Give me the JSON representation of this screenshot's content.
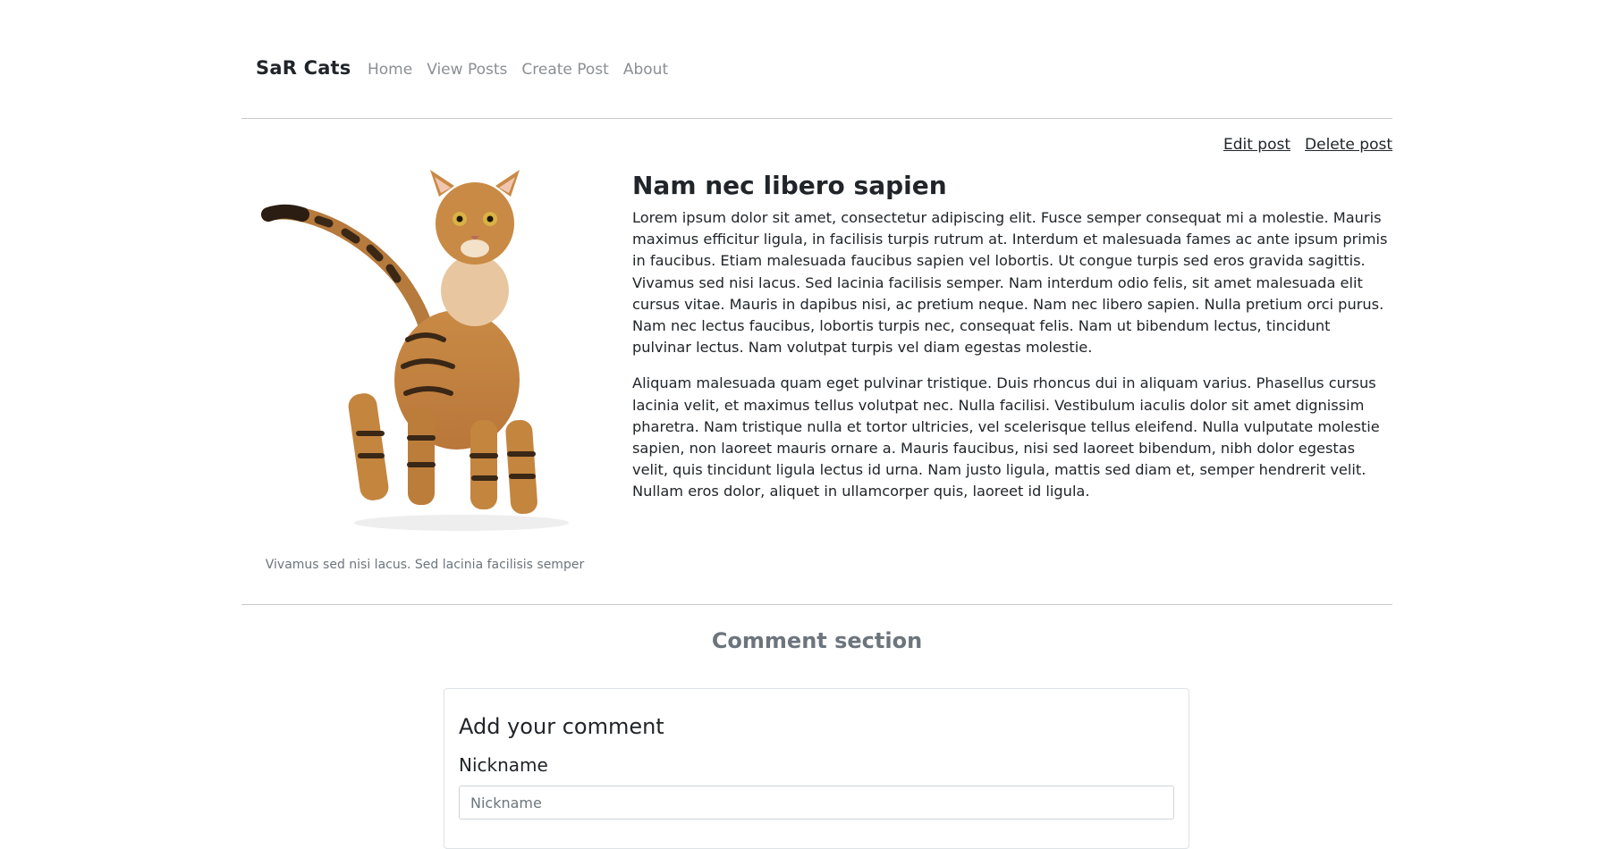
{
  "navbar": {
    "brand": "SaR Cats",
    "links": [
      "Home",
      "View Posts",
      "Create Post",
      "About"
    ]
  },
  "post_actions": {
    "edit_label": "Edit post",
    "delete_label": "Delete post"
  },
  "post": {
    "image_caption": "Vivamus sed nisi lacus. Sed lacinia facilisis semper",
    "title": "Nam nec libero sapien",
    "paragraphs": [
      "Lorem ipsum dolor sit amet, consectetur adipiscing elit. Fusce semper consequat mi a molestie. Mauris maximus efficitur ligula, in facilisis turpis rutrum at. Interdum et malesuada fames ac ante ipsum primis in faucibus. Etiam malesuada faucibus sapien vel lobortis. Ut congue turpis sed eros gravida sagittis. Vivamus sed nisi lacus. Sed lacinia facilisis semper. Nam interdum odio felis, sit amet malesuada elit cursus vitae. Mauris in dapibus nisi, ac pretium neque. Nam nec libero sapien. Nulla pretium orci purus. Nam nec lectus faucibus, lobortis turpis nec, consequat felis. Nam ut bibendum lectus, tincidunt pulvinar lectus. Nam volutpat turpis vel diam egestas molestie.",
      "Aliquam malesuada quam eget pulvinar tristique. Duis rhoncus dui in aliquam varius. Phasellus cursus lacinia velit, et maximus tellus volutpat nec. Nulla facilisi. Vestibulum iaculis dolor sit amet dignissim pharetra. Nam tristique nulla et tortor ultricies, vel scelerisque tellus eleifend. Nulla vulputate molestie sapien, non laoreet mauris ornare a. Mauris faucibus, nisi sed laoreet bibendum, nibh dolor egestas velit, quis tincidunt ligula lectus id urna. Nam justo ligula, mattis sed diam et, semper hendrerit velit. Nullam eros dolor, aliquet in ullamcorper quis, laoreet id ligula."
    ]
  },
  "comments": {
    "section_heading": "Comment section",
    "form_title": "Add your comment",
    "nickname_label": "Nickname",
    "nickname_placeholder": "Nickname",
    "nickname_value": ""
  },
  "colors": {
    "text": "#212529",
    "muted": "#6c757d",
    "nav_link": "#8b8f93",
    "border": "#dee2e6"
  }
}
